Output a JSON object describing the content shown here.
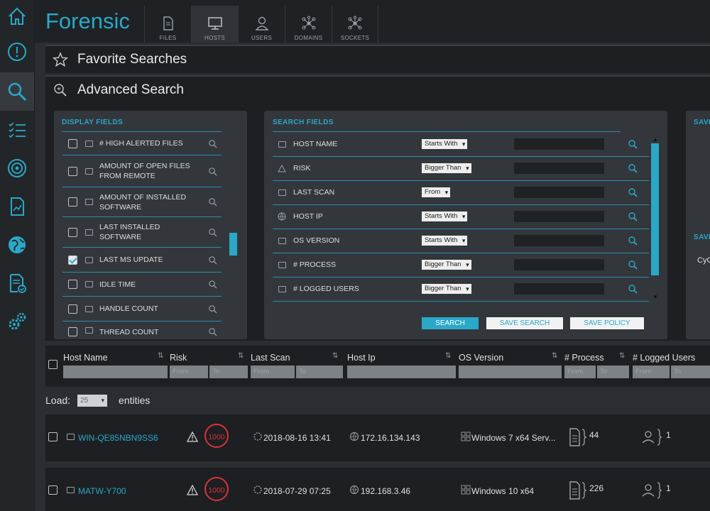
{
  "brand": "Forensic",
  "tabs": [
    {
      "label": "FILES",
      "icon": "file-icon",
      "active": false
    },
    {
      "label": "HOSTS",
      "icon": "monitor-icon",
      "active": true
    },
    {
      "label": "USERS",
      "icon": "user-icon",
      "active": false
    },
    {
      "label": "DOMAINS",
      "icon": "network-icon",
      "active": false
    },
    {
      "label": "SOCKETS",
      "icon": "network-icon",
      "active": false
    }
  ],
  "sidebar": [
    "home-icon",
    "alert-icon",
    "search-icon",
    "checklist-icon",
    "radar-icon",
    "report-icon",
    "globe-icon",
    "document-check-icon",
    "gears-icon"
  ],
  "favorite_searches": "Favorite Searches",
  "advanced_search": "Advanced Search",
  "display_fields": {
    "title": "DISPLAY FIELDS",
    "items": [
      {
        "label": "# HIGH ALERTED FILES",
        "checked": false
      },
      {
        "label": "AMOUNT OF OPEN FILES FROM REMOTE",
        "checked": false
      },
      {
        "label": "AMOUNT OF INSTALLED SOFTWARE",
        "checked": false
      },
      {
        "label": "LAST INSTALLED SOFTWARE",
        "checked": false
      },
      {
        "label": "LAST MS UPDATE",
        "checked": true
      },
      {
        "label": "IDLE TIME",
        "checked": false
      },
      {
        "label": "HANDLE COUNT",
        "checked": false
      },
      {
        "label": "THREAD COUNT",
        "checked": false
      }
    ]
  },
  "search_fields": {
    "title": "SEARCH FIELDS",
    "items": [
      {
        "label": "HOST NAME",
        "op": "Starts With"
      },
      {
        "label": "RISK",
        "op": "Bigger Than"
      },
      {
        "label": "LAST SCAN",
        "op": "From"
      },
      {
        "label": "HOST IP",
        "op": "Starts With"
      },
      {
        "label": "OS VERSION",
        "op": "Starts With"
      },
      {
        "label": "# PROCESS",
        "op": "Bigger Than"
      },
      {
        "label": "# LOGGED USERS",
        "op": "Bigger Than"
      }
    ],
    "search_btn": "SEARCH",
    "save_search_btn": "SAVE SEARCH",
    "save_policy_btn": "SAVE POLICY"
  },
  "right_panel": {
    "title1": "SAVED",
    "title2": "SAVED",
    "item": "CyC"
  },
  "columns": [
    "Host Name",
    "Risk",
    "Last Scan",
    "Host Ip",
    "OS Version",
    "# Process",
    "# Logged Users"
  ],
  "filter": {
    "from": "From",
    "to": "To"
  },
  "load": {
    "label": "Load:",
    "value": "25",
    "suffix": "entities"
  },
  "rows": [
    {
      "host": "WIN-QE85NBN9SS6",
      "risk": "1000",
      "last_scan": "2018-08-16 13:41",
      "ip": "172.16.134.143",
      "os": "Windows 7 x64 Serv...",
      "process": "44",
      "users": "1"
    },
    {
      "host": "MATW-Y700",
      "risk": "1000",
      "last_scan": "2018-07-29 07:25",
      "ip": "192.168.3.46",
      "os": "Windows 10 x64",
      "process": "226",
      "users": "1"
    }
  ],
  "colors": {
    "accent": "#2aa8c8",
    "risk": "#d9333a"
  }
}
